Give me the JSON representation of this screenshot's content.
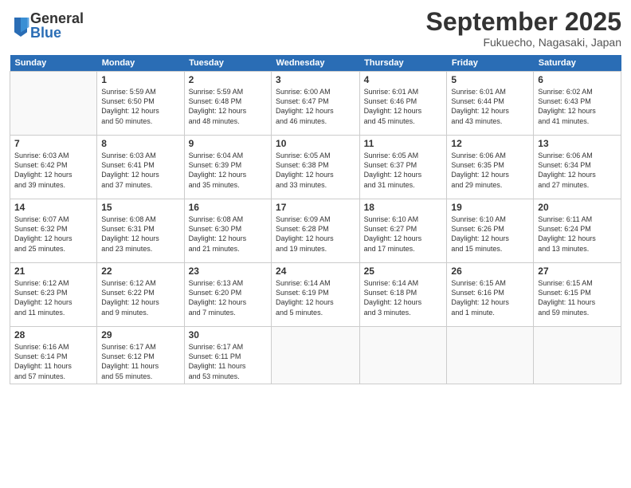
{
  "logo": {
    "general": "General",
    "blue": "Blue"
  },
  "title": "September 2025",
  "subtitle": "Fukuecho, Nagasaki, Japan",
  "days_header": [
    "Sunday",
    "Monday",
    "Tuesday",
    "Wednesday",
    "Thursday",
    "Friday",
    "Saturday"
  ],
  "weeks": [
    [
      {
        "day": "",
        "info": ""
      },
      {
        "day": "1",
        "info": "Sunrise: 5:59 AM\nSunset: 6:50 PM\nDaylight: 12 hours\nand 50 minutes."
      },
      {
        "day": "2",
        "info": "Sunrise: 5:59 AM\nSunset: 6:48 PM\nDaylight: 12 hours\nand 48 minutes."
      },
      {
        "day": "3",
        "info": "Sunrise: 6:00 AM\nSunset: 6:47 PM\nDaylight: 12 hours\nand 46 minutes."
      },
      {
        "day": "4",
        "info": "Sunrise: 6:01 AM\nSunset: 6:46 PM\nDaylight: 12 hours\nand 45 minutes."
      },
      {
        "day": "5",
        "info": "Sunrise: 6:01 AM\nSunset: 6:44 PM\nDaylight: 12 hours\nand 43 minutes."
      },
      {
        "day": "6",
        "info": "Sunrise: 6:02 AM\nSunset: 6:43 PM\nDaylight: 12 hours\nand 41 minutes."
      }
    ],
    [
      {
        "day": "7",
        "info": "Sunrise: 6:03 AM\nSunset: 6:42 PM\nDaylight: 12 hours\nand 39 minutes."
      },
      {
        "day": "8",
        "info": "Sunrise: 6:03 AM\nSunset: 6:41 PM\nDaylight: 12 hours\nand 37 minutes."
      },
      {
        "day": "9",
        "info": "Sunrise: 6:04 AM\nSunset: 6:39 PM\nDaylight: 12 hours\nand 35 minutes."
      },
      {
        "day": "10",
        "info": "Sunrise: 6:05 AM\nSunset: 6:38 PM\nDaylight: 12 hours\nand 33 minutes."
      },
      {
        "day": "11",
        "info": "Sunrise: 6:05 AM\nSunset: 6:37 PM\nDaylight: 12 hours\nand 31 minutes."
      },
      {
        "day": "12",
        "info": "Sunrise: 6:06 AM\nSunset: 6:35 PM\nDaylight: 12 hours\nand 29 minutes."
      },
      {
        "day": "13",
        "info": "Sunrise: 6:06 AM\nSunset: 6:34 PM\nDaylight: 12 hours\nand 27 minutes."
      }
    ],
    [
      {
        "day": "14",
        "info": "Sunrise: 6:07 AM\nSunset: 6:32 PM\nDaylight: 12 hours\nand 25 minutes."
      },
      {
        "day": "15",
        "info": "Sunrise: 6:08 AM\nSunset: 6:31 PM\nDaylight: 12 hours\nand 23 minutes."
      },
      {
        "day": "16",
        "info": "Sunrise: 6:08 AM\nSunset: 6:30 PM\nDaylight: 12 hours\nand 21 minutes."
      },
      {
        "day": "17",
        "info": "Sunrise: 6:09 AM\nSunset: 6:28 PM\nDaylight: 12 hours\nand 19 minutes."
      },
      {
        "day": "18",
        "info": "Sunrise: 6:10 AM\nSunset: 6:27 PM\nDaylight: 12 hours\nand 17 minutes."
      },
      {
        "day": "19",
        "info": "Sunrise: 6:10 AM\nSunset: 6:26 PM\nDaylight: 12 hours\nand 15 minutes."
      },
      {
        "day": "20",
        "info": "Sunrise: 6:11 AM\nSunset: 6:24 PM\nDaylight: 12 hours\nand 13 minutes."
      }
    ],
    [
      {
        "day": "21",
        "info": "Sunrise: 6:12 AM\nSunset: 6:23 PM\nDaylight: 12 hours\nand 11 minutes."
      },
      {
        "day": "22",
        "info": "Sunrise: 6:12 AM\nSunset: 6:22 PM\nDaylight: 12 hours\nand 9 minutes."
      },
      {
        "day": "23",
        "info": "Sunrise: 6:13 AM\nSunset: 6:20 PM\nDaylight: 12 hours\nand 7 minutes."
      },
      {
        "day": "24",
        "info": "Sunrise: 6:14 AM\nSunset: 6:19 PM\nDaylight: 12 hours\nand 5 minutes."
      },
      {
        "day": "25",
        "info": "Sunrise: 6:14 AM\nSunset: 6:18 PM\nDaylight: 12 hours\nand 3 minutes."
      },
      {
        "day": "26",
        "info": "Sunrise: 6:15 AM\nSunset: 6:16 PM\nDaylight: 12 hours\nand 1 minute."
      },
      {
        "day": "27",
        "info": "Sunrise: 6:15 AM\nSunset: 6:15 PM\nDaylight: 11 hours\nand 59 minutes."
      }
    ],
    [
      {
        "day": "28",
        "info": "Sunrise: 6:16 AM\nSunset: 6:14 PM\nDaylight: 11 hours\nand 57 minutes."
      },
      {
        "day": "29",
        "info": "Sunrise: 6:17 AM\nSunset: 6:12 PM\nDaylight: 11 hours\nand 55 minutes."
      },
      {
        "day": "30",
        "info": "Sunrise: 6:17 AM\nSunset: 6:11 PM\nDaylight: 11 hours\nand 53 minutes."
      },
      {
        "day": "",
        "info": ""
      },
      {
        "day": "",
        "info": ""
      },
      {
        "day": "",
        "info": ""
      },
      {
        "day": "",
        "info": ""
      }
    ]
  ]
}
